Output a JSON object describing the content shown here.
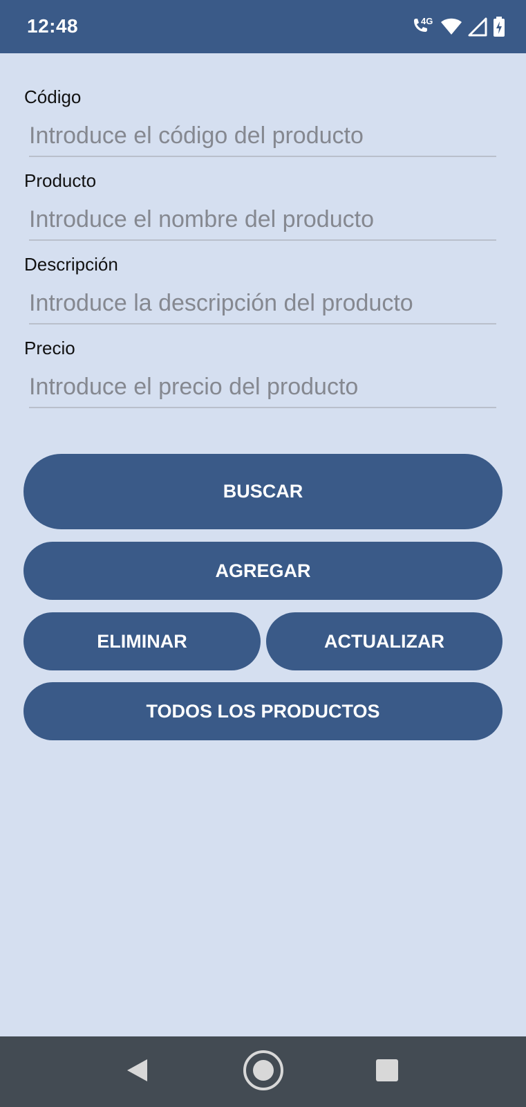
{
  "status_bar": {
    "time": "12:48",
    "network_label": "4G",
    "icons": [
      "wifi-calling-icon",
      "wifi-icon",
      "signal-icon",
      "battery-charging-icon"
    ]
  },
  "form": {
    "fields": [
      {
        "label": "Código",
        "placeholder": "Introduce el código del producto",
        "value": ""
      },
      {
        "label": "Producto",
        "placeholder": "Introduce el nombre del producto",
        "value": ""
      },
      {
        "label": "Descripción",
        "placeholder": "Introduce la descripción del producto",
        "value": ""
      },
      {
        "label": "Precio",
        "placeholder": "Introduce el precio del producto",
        "value": ""
      }
    ]
  },
  "buttons": {
    "search": "BUSCAR",
    "add": "AGREGAR",
    "delete": "ELIMINAR",
    "update": "ACTUALIZAR",
    "all_products": "TODOS LOS PRODUCTOS"
  },
  "nav_bar": {
    "icons": [
      "back-icon",
      "home-icon",
      "recents-icon"
    ]
  },
  "colors": {
    "primary": "#3a5a88",
    "background": "#d5dff0",
    "nav_bar": "#434b53"
  }
}
